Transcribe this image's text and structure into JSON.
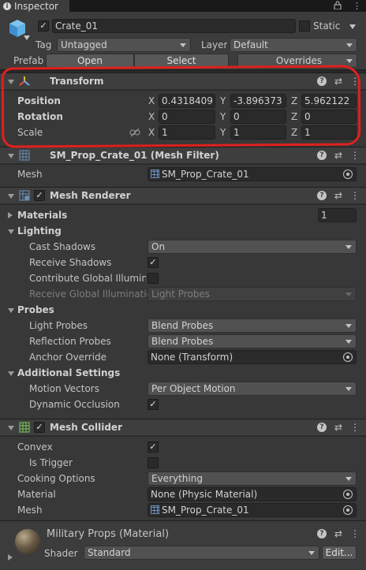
{
  "tab": {
    "label": "Inspector"
  },
  "header": {
    "object_name": "Crate_01",
    "static_label": "Static",
    "tag_label": "Tag",
    "tag_value": "Untagged",
    "layer_label": "Layer",
    "layer_value": "Default",
    "prefab_label": "Prefab",
    "open_label": "Open",
    "select_label": "Select",
    "overrides_label": "Overrides"
  },
  "transform": {
    "title": "Transform",
    "position_label": "Position",
    "rotation_label": "Rotation",
    "scale_label": "Scale",
    "x": "X",
    "y": "Y",
    "z": "Z",
    "position": [
      "0.4318409",
      "-3.896373",
      "5.962122"
    ],
    "rotation": [
      "0",
      "0",
      "0"
    ],
    "scale": [
      "1",
      "1",
      "1"
    ]
  },
  "mesh_filter": {
    "title": "SM_Prop_Crate_01 (Mesh Filter)",
    "mesh_label": "Mesh",
    "mesh_value": "SM_Prop_Crate_01"
  },
  "mesh_renderer": {
    "title": "Mesh Renderer",
    "materials_label": "Materials",
    "materials_count": "1",
    "lighting_label": "Lighting",
    "cast_shadows_label": "Cast Shadows",
    "cast_shadows_value": "On",
    "receive_shadows_label": "Receive Shadows",
    "contribute_gi_label": "Contribute Global Illuminat",
    "receive_gi_label": "Receive Global Illumination",
    "receive_gi_value": "Light Probes",
    "probes_label": "Probes",
    "light_probes_label": "Light Probes",
    "light_probes_value": "Blend Probes",
    "reflection_probes_label": "Reflection Probes",
    "reflection_probes_value": "Blend Probes",
    "anchor_override_label": "Anchor Override",
    "anchor_override_value": "None (Transform)",
    "additional_label": "Additional Settings",
    "motion_vectors_label": "Motion Vectors",
    "motion_vectors_value": "Per Object Motion",
    "dynamic_occlusion_label": "Dynamic Occlusion"
  },
  "mesh_collider": {
    "title": "Mesh Collider",
    "convex_label": "Convex",
    "is_trigger_label": "Is Trigger",
    "cooking_label": "Cooking Options",
    "cooking_value": "Everything",
    "material_label": "Material",
    "material_value": "None (Physic Material)",
    "mesh_label": "Mesh",
    "mesh_value": "SM_Prop_Crate_01"
  },
  "material": {
    "title": "Military Props (Material)",
    "shader_label": "Shader",
    "shader_value": "Standard",
    "edit_label": "Edit..."
  },
  "checkmark": "✓",
  "colors": {
    "highlight_outline": "#e0201e",
    "background": "#383838",
    "header": "#3e3e3e"
  }
}
